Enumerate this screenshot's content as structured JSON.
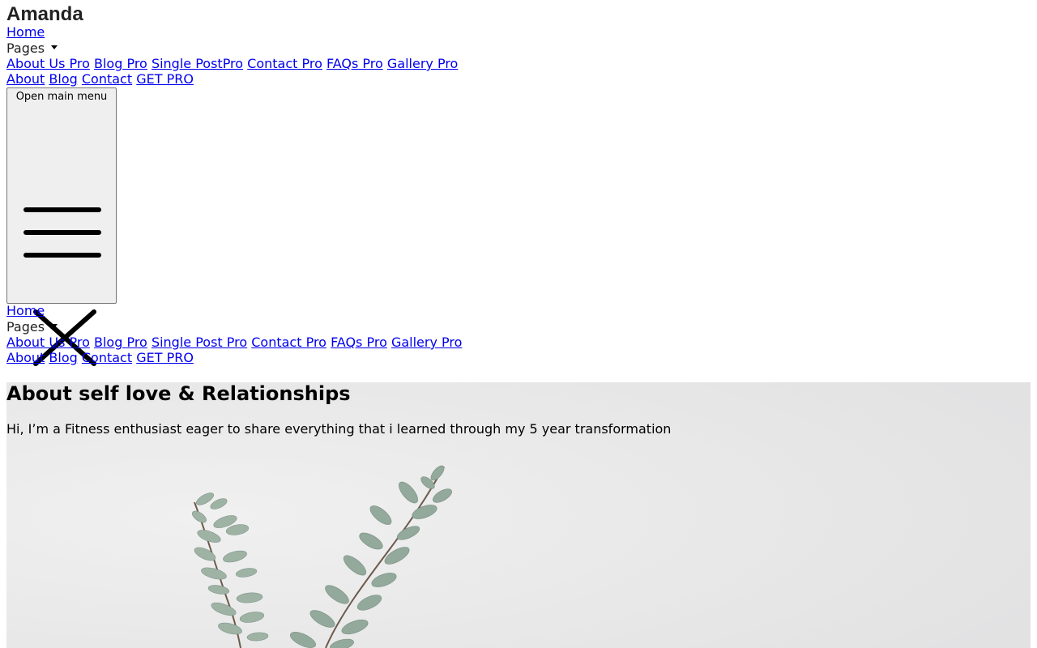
{
  "brand": "Amanda",
  "header_nav": {
    "home": "Home",
    "pages": "Pages",
    "pro_links": [
      "About Us Pro",
      "Blog Pro",
      "Single PostPro",
      "Contact Pro",
      "FAQs Pro",
      "Gallery Pro"
    ],
    "links": [
      "About",
      "Blog",
      "Contact",
      "GET PRO"
    ]
  },
  "menu_button": {
    "label": "Open main menu",
    "icons": [
      "hamburger-icon",
      "close-icon"
    ]
  },
  "mobile_nav": {
    "home": "Home",
    "pages": "Pages",
    "pro_links": [
      "About Us Pro",
      "Blog Pro",
      "Single Post Pro",
      "Contact Pro",
      "FAQs Pro",
      "Gallery Pro"
    ],
    "links": [
      "About",
      "Blog",
      "Contact",
      "GET PRO"
    ]
  },
  "hero": {
    "title": "About self love & Relationships",
    "text": "Hi, I’m a Fitness enthusiast eager to share everything that i learned through my 5 year transformation",
    "image": "eucalyptus-plant-image"
  },
  "colors": {
    "link": "#0000ee",
    "text": "#000000",
    "brand_text": "#222222",
    "button_bg": "#efefef",
    "hero_bg": "#e9e9e9"
  }
}
